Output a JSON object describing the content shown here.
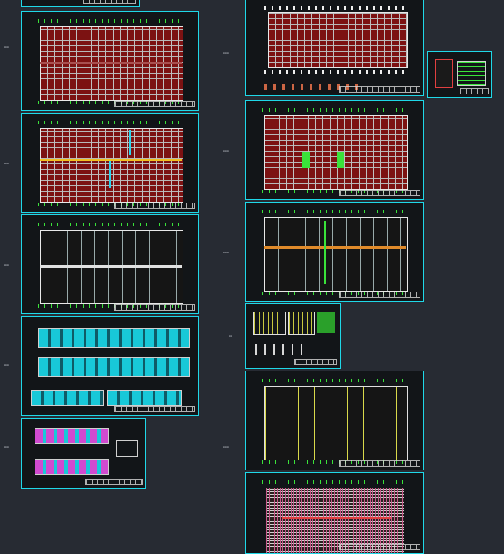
{
  "canvas": {
    "background": "#272b33",
    "frame_color": "#1fd8e8",
    "accent_red": "#7c1212",
    "accent_green": "#3ae23a",
    "accent_cyan": "#18c8d8"
  },
  "sheets": [
    {
      "id": "plan-1",
      "type": "red-grid-plan"
    },
    {
      "id": "plan-2",
      "type": "red-grid-plan-with-lines"
    },
    {
      "id": "plan-3",
      "type": "roof-plan"
    },
    {
      "id": "elev-1",
      "type": "elevations"
    },
    {
      "id": "elev-2",
      "type": "elevations-small"
    },
    {
      "id": "found-1",
      "type": "foundation-plan"
    },
    {
      "id": "detail-1",
      "type": "detail"
    },
    {
      "id": "found-2",
      "type": "column-plan"
    },
    {
      "id": "beam-1",
      "type": "beam-plan"
    },
    {
      "id": "detail-2",
      "type": "section-details"
    },
    {
      "id": "roof-1",
      "type": "roof-truss-plan"
    },
    {
      "id": "roof-2",
      "type": "dense-plan"
    }
  ]
}
